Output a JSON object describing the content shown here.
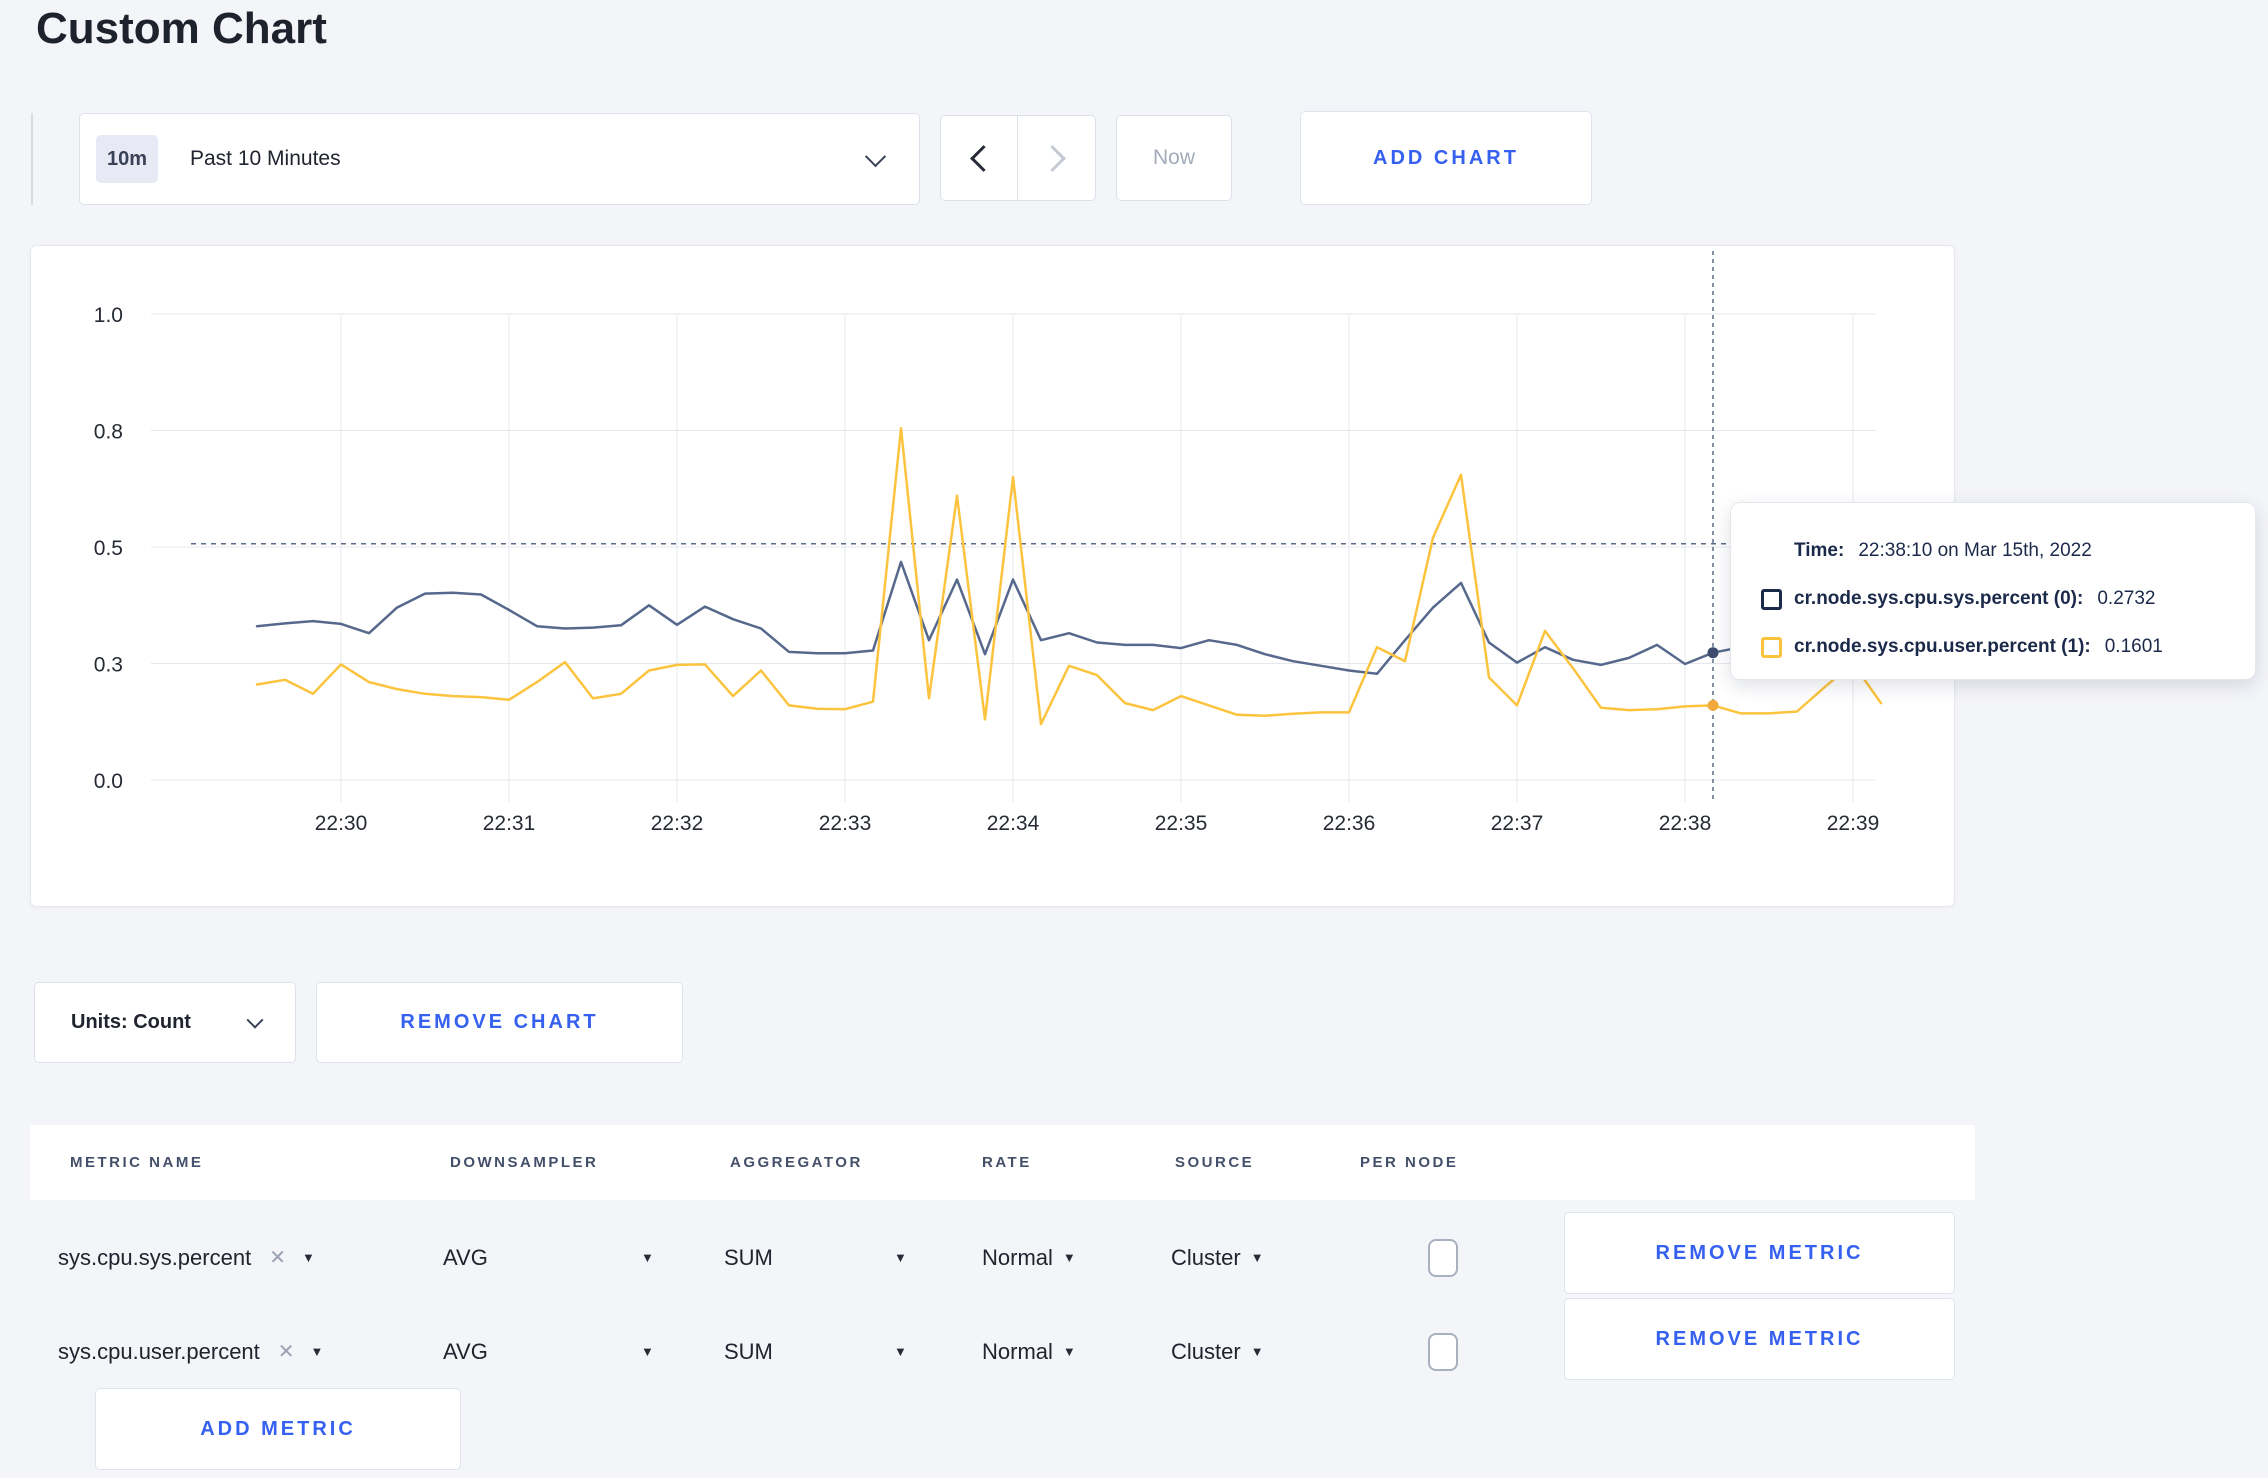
{
  "page": {
    "title": "Custom Chart"
  },
  "colors": {
    "accent_blue": "#3560f0",
    "page_bg": "#f4f5f9",
    "navy": "#1b2a4a",
    "series_sys": "#56688c",
    "series_user": "#fcc43e"
  },
  "toolbar": {
    "time_badge": "10m",
    "time_label": "Past 10 Minutes",
    "now_label": "Now",
    "add_chart_label": "ADD CHART"
  },
  "chart_data": {
    "type": "line",
    "title": "",
    "xlabel": "",
    "ylabel": "",
    "start_time": "22:29:30",
    "interval_seconds": 10,
    "x_ticks": [
      "22:30",
      "22:31",
      "22:32",
      "22:33",
      "22:34",
      "22:35",
      "22:36",
      "22:37",
      "22:38",
      "22:39"
    ],
    "y_ticks": [
      {
        "label": "0.0",
        "value": 0
      },
      {
        "label": "0.3",
        "value": 0.25
      },
      {
        "label": "0.5",
        "value": 0.5
      },
      {
        "label": "0.8",
        "value": 0.75
      },
      {
        "label": "1.0",
        "value": 1.0
      }
    ],
    "ylim": [
      0,
      1
    ],
    "grid": true,
    "legend_position": "none",
    "series": [
      {
        "name": "cr.node.sys.cpu.sys.percent",
        "color": "#56688c",
        "marker_color": "#3d4c6e",
        "values": [
          0.33,
          0.336,
          0.341,
          0.335,
          0.315,
          0.37,
          0.4,
          0.402,
          0.398,
          0.365,
          0.33,
          0.325,
          0.327,
          0.332,
          0.375,
          0.333,
          0.372,
          0.345,
          0.325,
          0.275,
          0.272,
          0.272,
          0.278,
          0.468,
          0.3,
          0.43,
          0.27,
          0.43,
          0.3,
          0.315,
          0.295,
          0.29,
          0.29,
          0.283,
          0.3,
          0.29,
          0.27,
          0.255,
          0.245,
          0.235,
          0.228,
          0.3,
          0.37,
          0.423,
          0.295,
          0.252,
          0.285,
          0.258,
          0.247,
          0.262,
          0.29,
          0.249,
          0.2732,
          0.285,
          0.28,
          0.285,
          0.28,
          0.28,
          0.285
        ]
      },
      {
        "name": "cr.node.sys.cpu.user.percent",
        "color": "#fcc43e",
        "marker_color": "#f3a93c",
        "values": [
          0.205,
          0.215,
          0.185,
          0.248,
          0.21,
          0.195,
          0.185,
          0.18,
          0.178,
          0.172,
          0.21,
          0.253,
          0.175,
          0.185,
          0.235,
          0.247,
          0.248,
          0.18,
          0.235,
          0.16,
          0.153,
          0.152,
          0.168,
          0.755,
          0.175,
          0.61,
          0.13,
          0.65,
          0.12,
          0.245,
          0.225,
          0.165,
          0.15,
          0.18,
          0.16,
          0.14,
          0.138,
          0.142,
          0.145,
          0.145,
          0.285,
          0.255,
          0.52,
          0.655,
          0.22,
          0.16,
          0.32,
          0.24,
          0.155,
          0.15,
          0.152,
          0.158,
          0.1601,
          0.143,
          0.143,
          0.147,
          0.2,
          0.25,
          0.165
        ]
      }
    ],
    "crosshair": {
      "time": "22:38:10",
      "x_index": 52,
      "hline_value": 0.507,
      "points": [
        {
          "series": 0,
          "value": 0.2732
        },
        {
          "series": 1,
          "value": 0.1601
        }
      ]
    }
  },
  "tooltip": {
    "time_label": "Time:",
    "time_value": "22:38:10 on Mar 15th, 2022",
    "series": [
      {
        "label": "cr.node.sys.cpu.sys.percent (0):",
        "value": "0.2732",
        "color": "#1b2a4a"
      },
      {
        "label": "cr.node.sys.cpu.user.percent (1):",
        "value": "0.1601",
        "color": "#fcc43e"
      }
    ]
  },
  "chart_footer": {
    "units_label": "Units: Count",
    "remove_chart_label": "REMOVE CHART"
  },
  "metrics_table": {
    "headers": [
      "METRIC NAME",
      "DOWNSAMPLER",
      "AGGREGATOR",
      "RATE",
      "SOURCE",
      "PER NODE"
    ],
    "rows": [
      {
        "metric": "sys.cpu.sys.percent",
        "downsampler": "AVG",
        "aggregator": "SUM",
        "rate": "Normal",
        "source": "Cluster",
        "per_node_checked": false,
        "remove_label": "REMOVE METRIC"
      },
      {
        "metric": "sys.cpu.user.percent",
        "downsampler": "AVG",
        "aggregator": "SUM",
        "rate": "Normal",
        "source": "Cluster",
        "per_node_checked": false,
        "remove_label": "REMOVE METRIC"
      }
    ],
    "add_metric_label": "ADD METRIC"
  }
}
